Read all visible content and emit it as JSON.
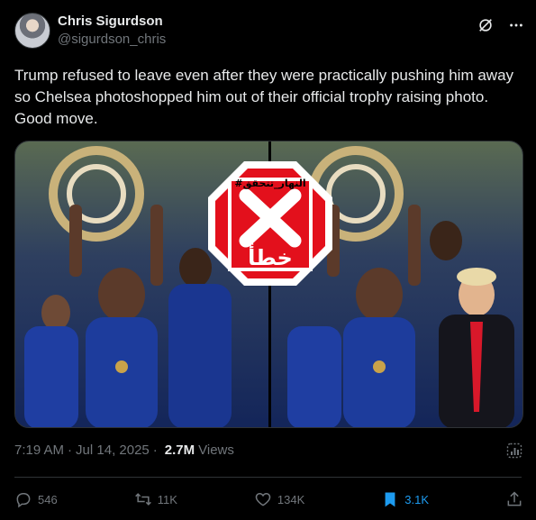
{
  "author": {
    "display_name": "Chris Sigurdson",
    "handle": "@sigurdson_chris",
    "avatar_icon": "avatar-photo"
  },
  "header_icons": [
    "grok-icon",
    "more-icon"
  ],
  "tweet": {
    "text": "Trump refused to leave even after they were practically pushing him away so Chelsea photoshopped him out of their official trophy raising photo. Good move."
  },
  "media": {
    "overlay_stamp": {
      "hashtag": "#النهار_تتحقق",
      "verdict": "خطأ",
      "color": "#e3101c"
    }
  },
  "meta": {
    "time": "7:19 AM",
    "date": "Jul 14, 2025",
    "views_count": "2.7M",
    "views_label": "Views"
  },
  "actions": {
    "replies": "546",
    "reposts": "11K",
    "likes": "134K",
    "bookmarks": "3.1K"
  },
  "colors": {
    "background": "#000000",
    "text": "#e7e9ea",
    "muted": "#71767b",
    "accent": "#1d9bf0",
    "border": "#2f3336"
  }
}
